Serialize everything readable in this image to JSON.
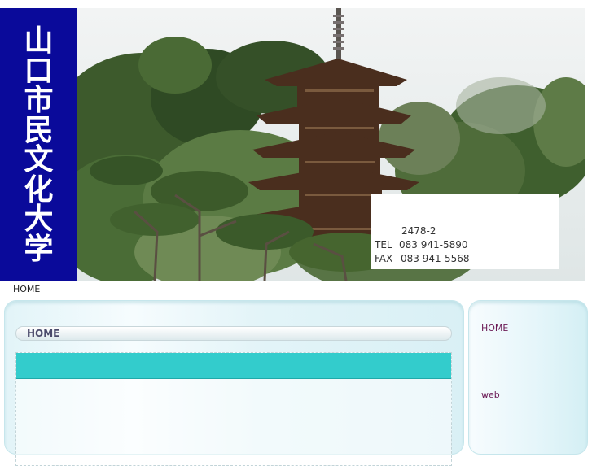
{
  "header": {
    "title_chars": [
      "山",
      "口",
      "市",
      "民",
      "文",
      "化",
      "大",
      "学"
    ],
    "contact": {
      "address": "2478-2",
      "tel_label": "TEL",
      "tel": "083 941-5890",
      "fax_label": "FAX",
      "fax": "083 941-5568"
    }
  },
  "breadcrumb": "HOME",
  "main": {
    "tab_label": "HOME"
  },
  "sidebar": {
    "links": [
      "HOME",
      "web"
    ]
  },
  "colors": {
    "title_band": "#0a0a9a",
    "teal_bar": "#33cccc",
    "link": "#6b1a55"
  }
}
